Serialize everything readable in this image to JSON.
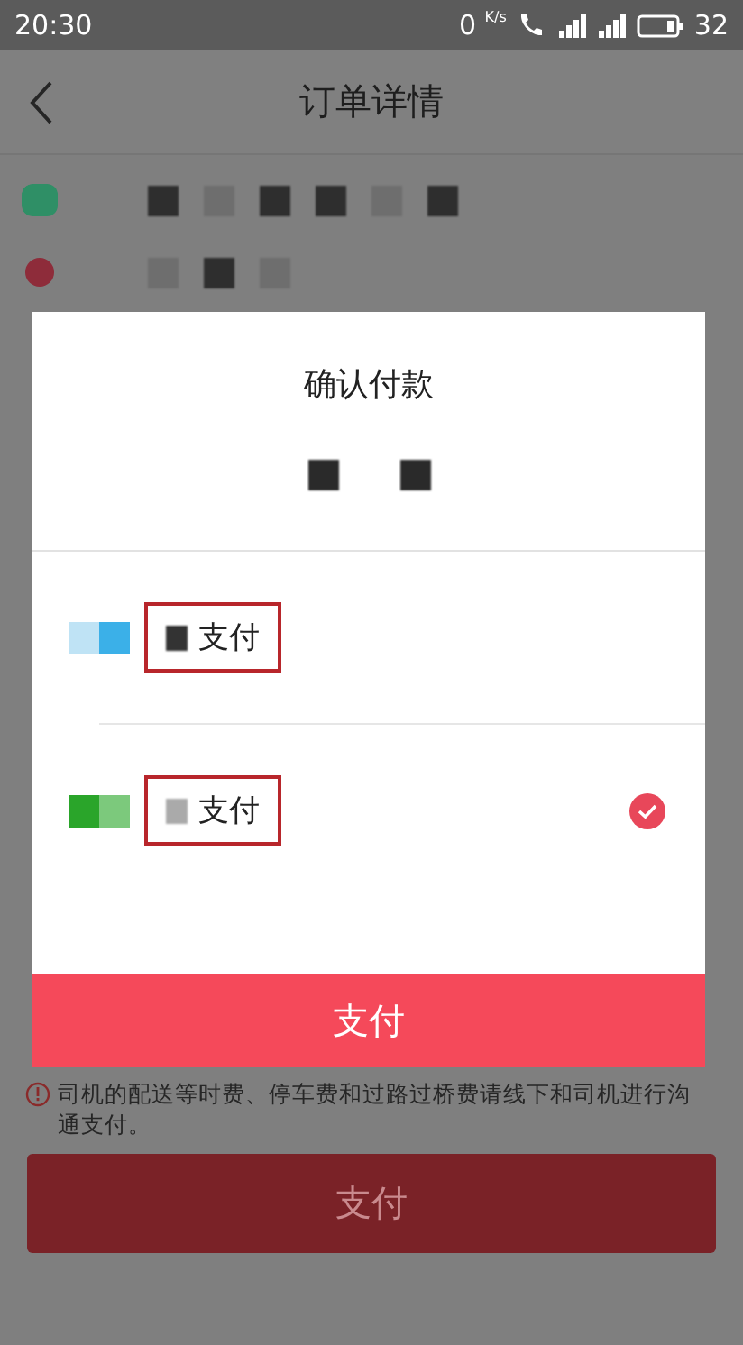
{
  "status_bar": {
    "time": "20:30",
    "net_speed": "0",
    "net_unit": "K/s",
    "battery": "32"
  },
  "header": {
    "title": "订单详情"
  },
  "dialog": {
    "title": "确认付款",
    "options": [
      {
        "label": "支付",
        "selected": false
      },
      {
        "label": "支付",
        "selected": true
      }
    ],
    "pay_button": "支付"
  },
  "notice": "司机的配送等时费、停车费和过路过桥费请线下和司机进行沟通支付。",
  "bottom_button": "支付"
}
